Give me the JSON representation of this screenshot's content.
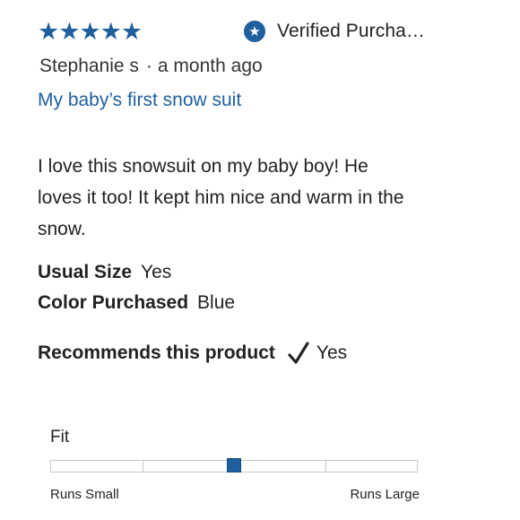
{
  "review": {
    "rating": 5,
    "stars_glyph": "★★★★★",
    "verified_label": "Verified Purcha…",
    "reviewer": "Stephanie s",
    "separator": "·",
    "date": "a month ago",
    "title": "My baby’s first snow suit",
    "body": "I love this snowsuit on my baby boy! He loves it too! It kept him nice and warm in the snow."
  },
  "attributes": [
    {
      "key": "Usual Size",
      "value": "Yes"
    },
    {
      "key": "Color Purchased",
      "value": "Blue"
    }
  ],
  "recommendation": {
    "label": "Recommends this product",
    "value": "Yes"
  },
  "fit": {
    "label": "Fit",
    "min_label": "Runs Small",
    "max_label": "Runs Large",
    "value_fraction": 0.5,
    "segments": 4
  },
  "colors": {
    "accent": "#1f5f9e",
    "text": "#222222"
  },
  "icons": {
    "verified": "star-in-circle-icon",
    "recommend": "checkmark-icon"
  }
}
